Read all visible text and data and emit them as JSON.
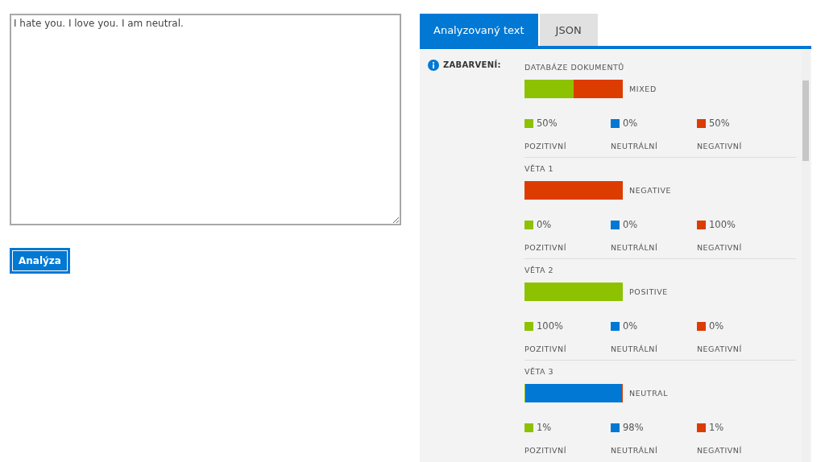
{
  "input": {
    "value": "I hate you. I love you. I am neutral."
  },
  "analyze_button": "Analýza",
  "tabs": [
    {
      "label": "Analyzovaný text",
      "selected": true
    },
    {
      "label": "JSON",
      "selected": false
    }
  ],
  "sentiment": {
    "label": "ZABARVENÍ:",
    "sections": [
      {
        "title": "DATABÁZE DOKUMENTŮ",
        "verdict": "MIXED",
        "segments": [
          {
            "color": "#8cc200",
            "level": 0.5
          },
          {
            "color": "#dc3c00",
            "level": 0.5
          }
        ],
        "legend": [
          {
            "color": "#8cc200",
            "value": "50%",
            "label": "POZITIVNÍ"
          },
          {
            "color": "#0078d4",
            "value": "0%",
            "label": "NEUTRÁLNÍ"
          },
          {
            "color": "#dc3c00",
            "value": "50%",
            "label": "NEGATIVNÍ"
          }
        ]
      },
      {
        "title": "VĚTA 1",
        "verdict": "NEGATIVE",
        "segments": [
          {
            "color": "#dc3c00",
            "level": 1
          }
        ],
        "legend": [
          {
            "color": "#8cc200",
            "value": "0%",
            "label": "POZITIVNÍ"
          },
          {
            "color": "#0078d4",
            "value": "0%",
            "label": "NEUTRÁLNÍ"
          },
          {
            "color": "#dc3c00",
            "value": "100%",
            "label": "NEGATIVNÍ"
          }
        ]
      },
      {
        "title": "VĚTA 2",
        "verdict": "POSITIVE",
        "segments": [
          {
            "color": "#8cc200",
            "level": 1
          }
        ],
        "legend": [
          {
            "color": "#8cc200",
            "value": "100%",
            "label": "POZITIVNÍ"
          },
          {
            "color": "#0078d4",
            "value": "0%",
            "label": "NEUTRÁLNÍ"
          },
          {
            "color": "#dc3c00",
            "value": "0%",
            "label": "NEGATIVNÍ"
          }
        ]
      },
      {
        "title": "VĚTA 3",
        "verdict": "NEUTRAL",
        "segments": [
          {
            "color": "#8cc200",
            "level": 0.01
          },
          {
            "color": "#0078d4",
            "level": 0.98
          },
          {
            "color": "#dc3c00",
            "level": 0.01
          }
        ],
        "legend": [
          {
            "color": "#8cc200",
            "value": "1%",
            "label": "POZITIVNÍ"
          },
          {
            "color": "#0078d4",
            "value": "98%",
            "label": "NEUTRÁLNÍ"
          },
          {
            "color": "#dc3c00",
            "value": "1%",
            "label": "NEGATIVNÍ"
          }
        ]
      }
    ]
  }
}
